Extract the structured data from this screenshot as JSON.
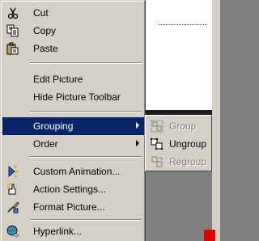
{
  "menu": {
    "items": [
      {
        "label": "Cut",
        "icon": "scissors-icon"
      },
      {
        "label": "Copy",
        "icon": "copy-icon"
      },
      {
        "label": "Paste",
        "icon": "paste-icon"
      },
      {
        "label": "Edit Picture"
      },
      {
        "label": "Hide Picture Toolbar"
      },
      {
        "label": "Grouping",
        "selected": true,
        "has_submenu": true
      },
      {
        "label": "Order",
        "has_submenu": true
      },
      {
        "label": "Custom Animation...",
        "icon": "custom-animation-icon"
      },
      {
        "label": "Action Settings...",
        "icon": "action-settings-icon"
      },
      {
        "label": "Format Picture...",
        "icon": "format-picture-icon"
      },
      {
        "label": "Hyperlink...",
        "icon": "hyperlink-icon"
      }
    ]
  },
  "submenu": {
    "items": [
      {
        "label": "Group",
        "enabled": false,
        "icon": "group-icon"
      },
      {
        "label": "Ungroup",
        "enabled": true,
        "icon": "ungroup-icon"
      },
      {
        "label": "Regroup",
        "enabled": false,
        "icon": "regroup-icon"
      }
    ]
  },
  "colors": {
    "menu_bg": "#d4d0c8",
    "highlight": "#0a246a",
    "disabled_text": "#808080"
  }
}
